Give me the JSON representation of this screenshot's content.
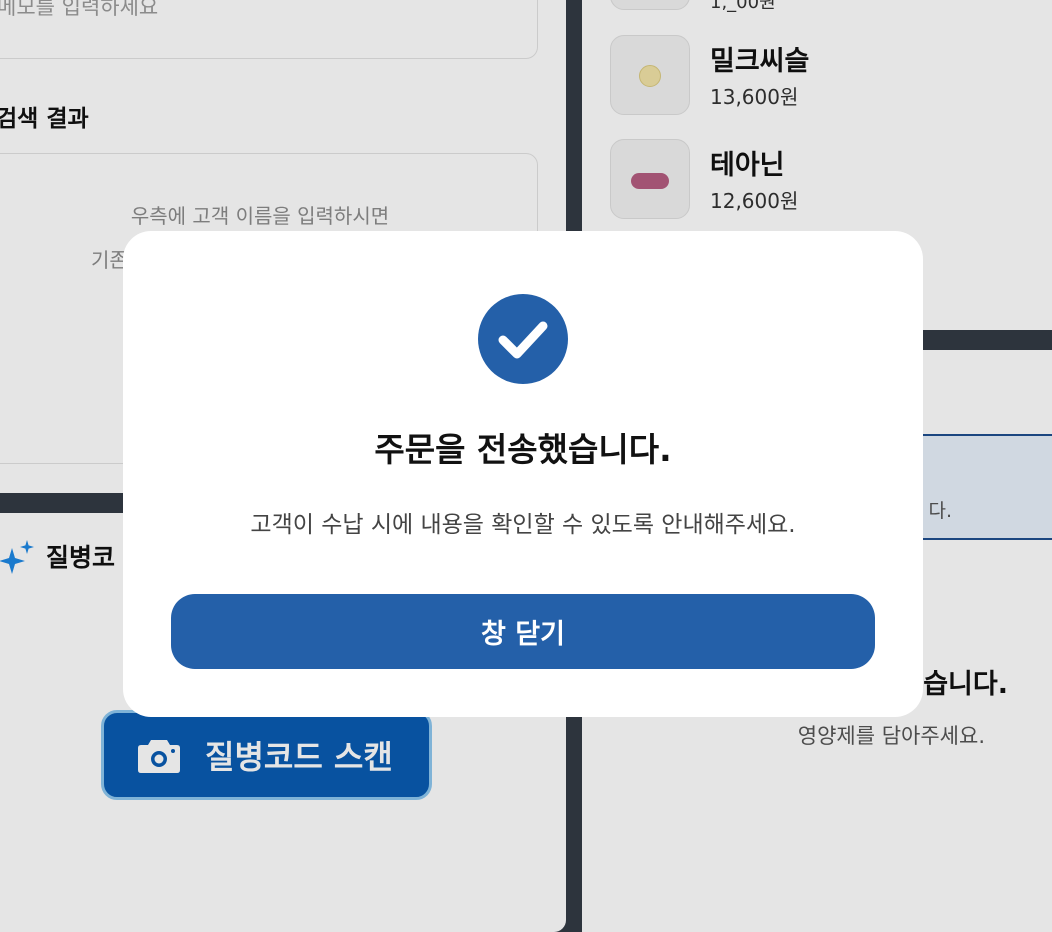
{
  "memo": {
    "placeholder": "메모를 입력하세요"
  },
  "search": {
    "title": "검색 결과",
    "empty_line1": "우측에 고객 이름을 입력하시면",
    "empty_line2_partial": "기존"
  },
  "ai_section": {
    "title_partial": "질병코"
  },
  "scan_button": {
    "label": "질병코드 스캔",
    "icon": "camera-icon"
  },
  "products": [
    {
      "name": "밀크씨슬",
      "price": "13,600원",
      "pill_color": "#f2e4a8"
    },
    {
      "name": "테아닌",
      "price": "12,600원",
      "pill_color": "#b55d80"
    }
  ],
  "partial_product": {
    "price_partial": "1,_00원"
  },
  "cart": {
    "info_text_partial": "다.",
    "empty_title_partial": "습니다.",
    "empty_sub_partial": "영양제를 담아주세요."
  },
  "modal": {
    "icon": "check-circle-icon",
    "title": "주문을 전송했습니다.",
    "message": "고객이 수납 시에 내용을 확인할 수 있도록 안내해주세요.",
    "close_label": "창 닫기"
  },
  "colors": {
    "primary": "#2460a9",
    "scan_button": "#0a5cb3",
    "divider": "#333a44"
  }
}
